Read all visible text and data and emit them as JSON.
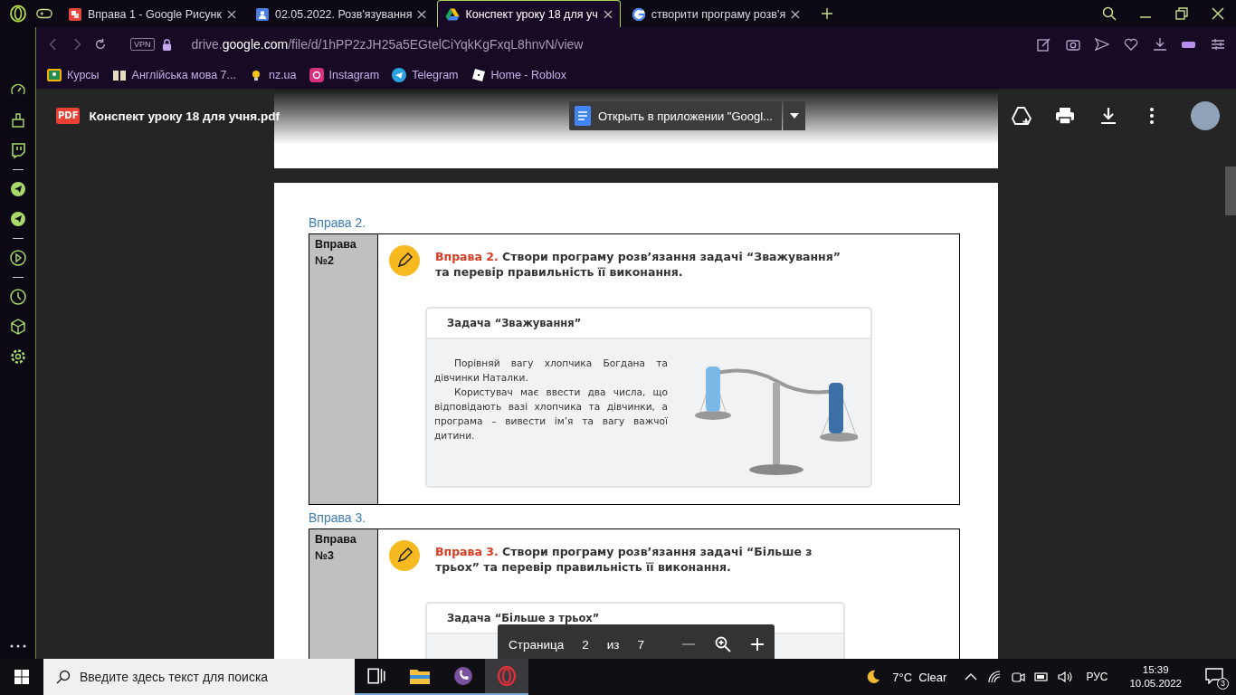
{
  "browser": {
    "tabs": [
      {
        "kind": "slides",
        "title": "Вправа 1 - Google Рисунк",
        "selected": false
      },
      {
        "kind": "classroom",
        "title": "02.05.2022. Розв'язування",
        "selected": false
      },
      {
        "kind": "drive",
        "title": "Конспект уроку 18 для уч",
        "selected": true
      },
      {
        "kind": "google",
        "title": "створити програму розв'я",
        "selected": false
      }
    ],
    "vpn_label": "VPN",
    "address": "drive.**google.com**/file/d/1hPP2zJH25a5EGtelCiYqkKgFxqL8hnvN/view",
    "bookmarks": [
      {
        "kind": "classroom",
        "label": "Курсы"
      },
      {
        "kind": "book",
        "label": "Англійська мова 7..."
      },
      {
        "kind": "bulb",
        "label": "nz.ua"
      },
      {
        "kind": "instagram",
        "label": "Instagram"
      },
      {
        "kind": "telegram",
        "label": "Telegram"
      },
      {
        "kind": "roblox",
        "label": "Home - Roblox"
      }
    ]
  },
  "viewer": {
    "file_badge": "PDF",
    "file_name": "Конспект уроку 18 для учня.pdf",
    "open_button": "Открыть в приложении \"Googl..."
  },
  "document": {
    "sections": [
      {
        "heading": "Вправа 2.",
        "label": "Вправа №2",
        "lead": "Вправа 2.",
        "title": "Створи програму розв’язання задачі “Зважування” та перевір правильність її виконання.",
        "task_title": "Задача “Зважування”",
        "paragraphs": [
          "Порівняй вагу хлопчика Богдана та дівчинки Наталки.",
          "Користувач має ввести два числа, що відповідають вазі хлопчика та дівчинки, а програма – вивести ім’я та вагу важчої дитини."
        ]
      },
      {
        "heading": "Вправа 3.",
        "label": "Вправа №3",
        "lead": "Вправа 3.",
        "title": "Створи програму розв’язання задачі “Більше з трьох” та перевір правильність її виконання.",
        "task_title": "Задача “Більше з трьох”"
      }
    ]
  },
  "page_toolbar": {
    "label": "Страница",
    "page": "2",
    "of": "из",
    "total": "7"
  },
  "taskbar": {
    "search_placeholder": "Введите здесь текст для поиска",
    "apps": [
      {
        "kind": "taskview",
        "selected": false
      },
      {
        "kind": "explorer",
        "selected": false
      },
      {
        "kind": "viber",
        "selected": false
      },
      {
        "kind": "opera",
        "selected": true
      }
    ],
    "weather": "7°C  Clear",
    "language": "РУС",
    "time": "15:39",
    "date": "10.05.2022",
    "notifications": "3"
  }
}
